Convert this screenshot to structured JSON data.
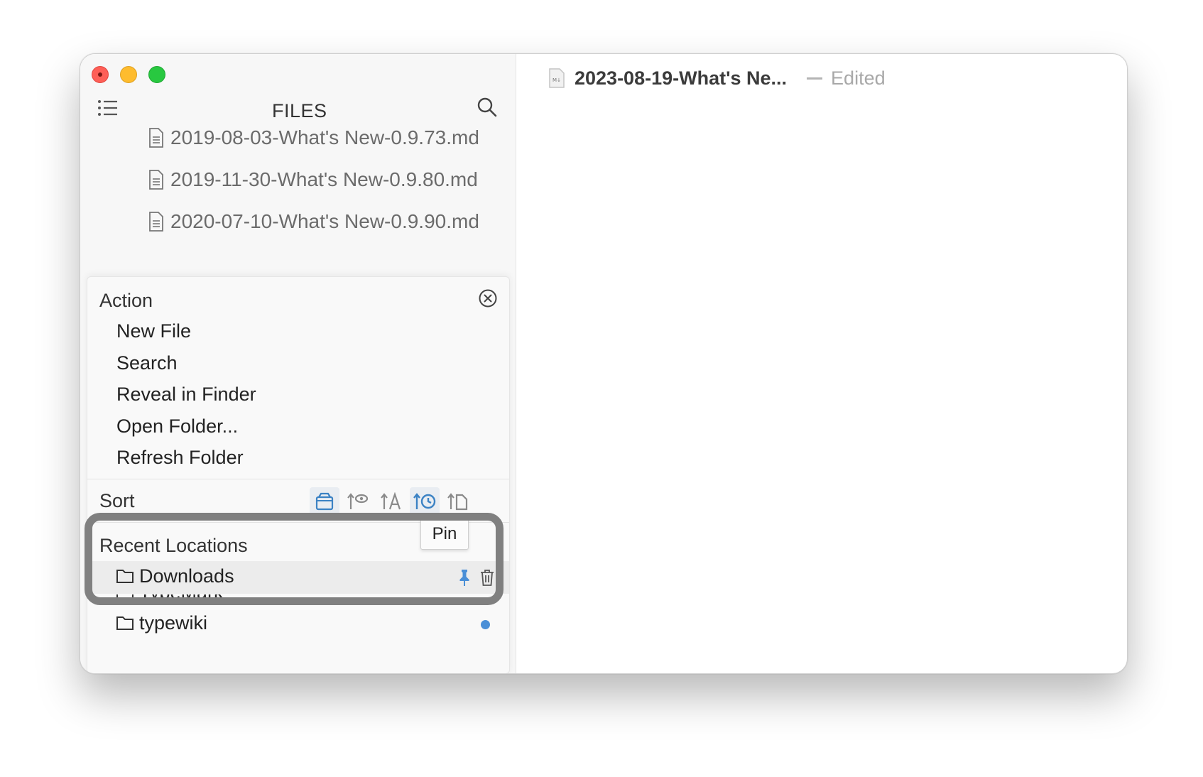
{
  "sidebar": {
    "title": "FILES",
    "files": [
      {
        "name": "2019-08-03-What's New-0.9.73.md"
      },
      {
        "name": "2019-11-30-What's New-0.9.80.md"
      },
      {
        "name": "2020-07-10-What's New-0.9.90.md"
      }
    ]
  },
  "panel": {
    "action_header": "Action",
    "actions": [
      "New File",
      "Search",
      "Reveal in Finder",
      "Open Folder...",
      "Refresh Folder"
    ],
    "sort_label": "Sort",
    "sort_buttons": [
      {
        "icon": "package-icon",
        "active": true
      },
      {
        "icon": "sort-by-views-icon",
        "active": false
      },
      {
        "icon": "sort-alphabetical-icon",
        "active": false
      },
      {
        "icon": "sort-by-time-icon",
        "active": true
      },
      {
        "icon": "sort-by-file-icon",
        "active": false
      }
    ],
    "recent_header": "Recent Locations",
    "recent_locations": [
      {
        "name": "Downloads",
        "hovered": true
      },
      {
        "name": "TypeMark"
      },
      {
        "name": "typewiki",
        "current": true
      }
    ],
    "tooltip": "Pin"
  },
  "document": {
    "title": "2023-08-19-What's Ne...",
    "status": "Edited",
    "icon_label": "M↓"
  },
  "colors": {
    "accent": "#4a8fd7",
    "highlight_border": "#808080"
  }
}
